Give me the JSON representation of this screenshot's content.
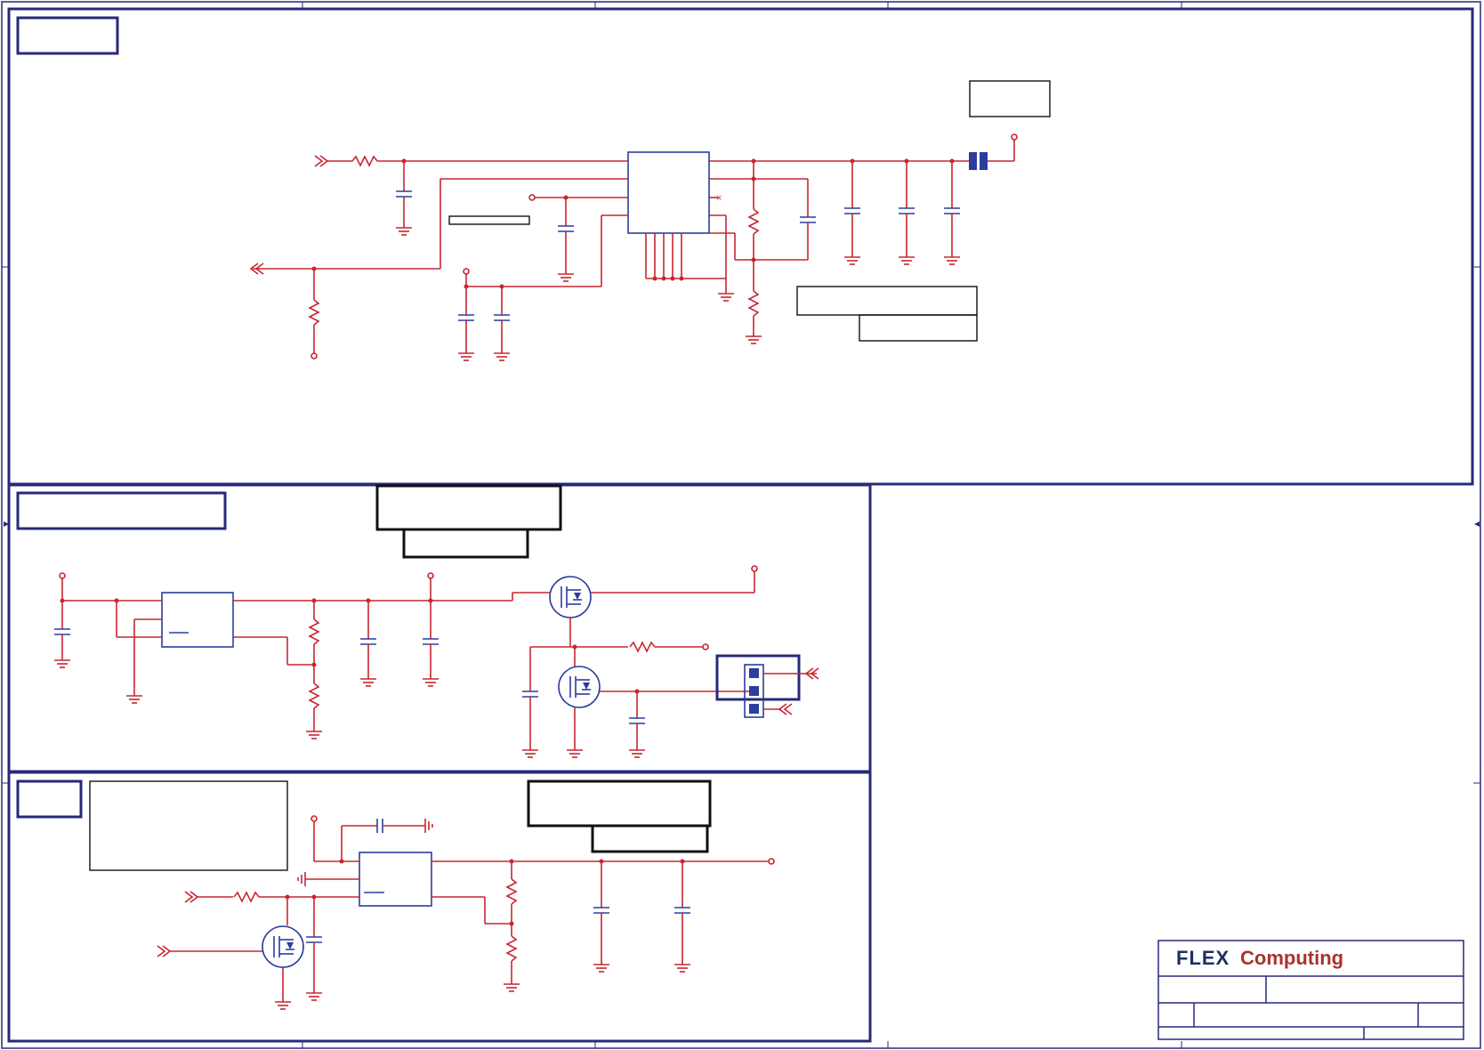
{
  "title_block": {
    "logo_brand": "FLEX",
    "logo_product": "Computing"
  }
}
